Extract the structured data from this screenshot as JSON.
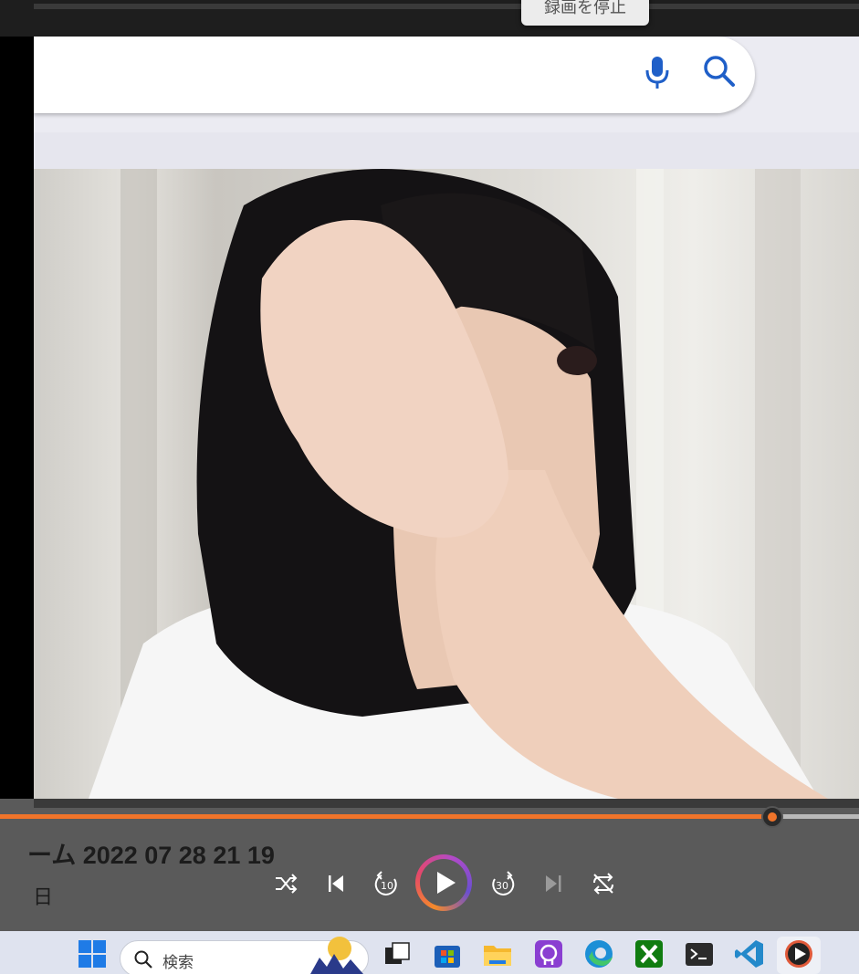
{
  "overlay": {
    "stop_recording_label": "録画を停止"
  },
  "browser": {
    "search": {
      "mic_icon": "microphone-icon",
      "search_icon": "search-icon"
    }
  },
  "player": {
    "title": "ーム 2022 07 28 21 19",
    "subtitle": "日",
    "progress": 0.9,
    "controls": [
      "shuffle-icon",
      "previous-icon",
      "rewind-10-icon",
      "play-icon",
      "forward-30-icon",
      "next-icon",
      "repeat-icon"
    ],
    "rewind_label": "10",
    "forward_label": "30",
    "accent_color": "#f0742a"
  },
  "taskbar": {
    "search_placeholder": "検索",
    "apps": [
      "start-icon",
      "task-view-icon",
      "store-icon",
      "file-explorer-icon",
      "app-icon",
      "edge-icon",
      "xbox-icon",
      "terminal-icon",
      "vscode-icon",
      "media-player-icon"
    ]
  }
}
